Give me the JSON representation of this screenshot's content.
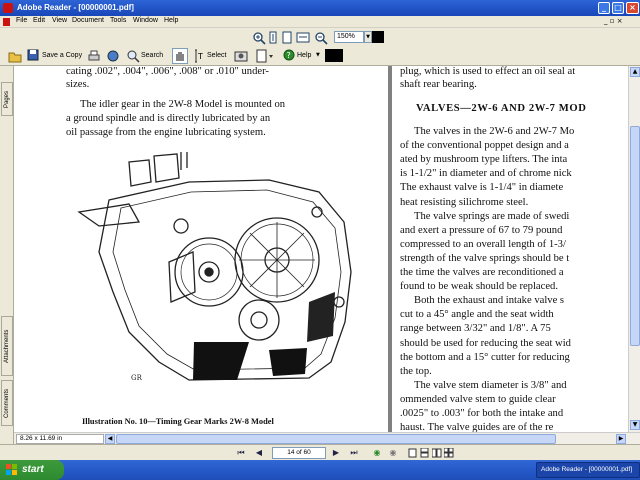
{
  "window": {
    "title": "Adobe Reader - [00000001.pdf]"
  },
  "menu": [
    "File",
    "Edit",
    "View",
    "Document",
    "Tools",
    "Window",
    "Help"
  ],
  "toolbar": {
    "save_copy": "Save a Copy",
    "search": "Search",
    "select": "Select",
    "help": "Help",
    "zoom": "150%"
  },
  "sidepanel": {
    "tabs": [
      "Pages",
      "Attachments",
      "Comments"
    ]
  },
  "document": {
    "left_page": {
      "lines_top": [
        "cating .002\", .004\", .006\", .008\" or .010\" under-",
        "sizes."
      ],
      "para": [
        "The idler gear in the 2W-8 Model is mounted on",
        "a ground spindle and is directly lubricated by an",
        "oil passage from the engine lubricating system."
      ],
      "caption": "Illustration No. 10—Timing Gear Marks 2W-8 Model"
    },
    "right_page": {
      "lines_top": [
        "plug, which is used to effect an oil seal at",
        "shaft rear bearing."
      ],
      "heading": "VALVES—2W-6 AND 2W-7 MOD",
      "body": [
        "The valves in the 2W-6 and 2W-7 Mo",
        "of the conventional poppet design and a",
        "ated by mushroom type lifters. The inta",
        "is 1-1/2\" in diameter and of chrome nick",
        "The exhaust valve is 1-1/4\" in diamete",
        "heat resisting silichrome steel.",
        "The valve springs are made of swedi",
        "and exert a pressure of 67 to 79 pound",
        "compressed to an overall length of 1-3/",
        "strength of the valve springs should be t",
        "the time the valves are reconditioned a",
        "found to be weak should be replaced.",
        "Both the exhaust and intake valve s",
        "cut to a 45° angle and the seat width",
        "range between 3/32\" and 1/8\". A 75",
        "should be used for reducing the seat wid",
        "the bottom and a 15° cutter for reducing",
        "the top.",
        "The valve stem diameter is 3/8\" and",
        "ommended valve stem to guide clear",
        ".0025\" to .003\" for both the intake and",
        "haust. The valve guides are of the re"
      ]
    }
  },
  "statusbar": {
    "page_size": "8.26 x 11.69 in",
    "page_indicator": "14 of 60"
  },
  "taskbar": {
    "start": "start",
    "item": "Adobe Reader - [00000001.pdf]"
  }
}
